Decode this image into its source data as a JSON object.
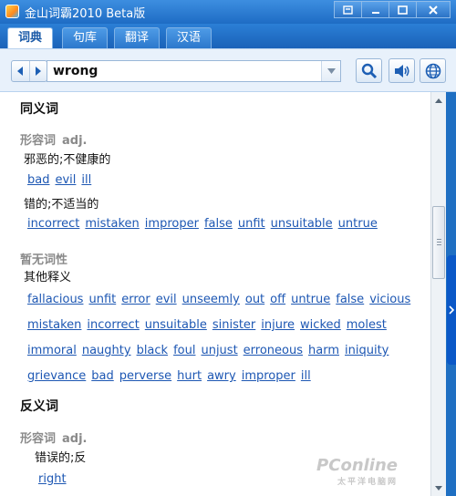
{
  "window": {
    "title": "金山词霸2010 Beta版"
  },
  "tabs": [
    {
      "label": "词典",
      "active": true
    },
    {
      "label": "句库",
      "active": false
    },
    {
      "label": "翻译",
      "active": false
    },
    {
      "label": "汉语",
      "active": false
    }
  ],
  "search": {
    "value": "wrong"
  },
  "icons": {
    "search": "search-icon",
    "speaker": "speaker-icon",
    "globe": "globe-icon"
  },
  "colors": {
    "accent": "#1f6fc2",
    "link": "#1d57b3"
  },
  "content": {
    "synonyms_title": "同义词",
    "syn_adj_cn": "形容词",
    "syn_adj_en": "adj.",
    "syn_gloss1": "邪恶的;不健康的",
    "syn_links1": [
      "bad",
      "evil",
      "ill"
    ],
    "syn_gloss2": "错的;不适当的",
    "syn_links2": [
      "incorrect",
      "mistaken",
      "improper",
      "false",
      "unfit",
      "unsuitable",
      "untrue"
    ],
    "syn_none_pos": "暂无词性",
    "syn_gloss3": "其他释义",
    "syn_links3a": [
      "fallacious",
      "unfit",
      "error",
      "evil",
      "unseemly",
      "out",
      "off",
      "untrue",
      "false",
      "vicious"
    ],
    "syn_links3b": [
      "mistaken",
      "incorrect",
      "unsuitable",
      "sinister",
      "injure",
      "wicked",
      "molest"
    ],
    "syn_links3c": [
      "immoral",
      "naughty",
      "black",
      "foul",
      "unjust",
      "erroneous",
      "harm",
      "iniquity"
    ],
    "syn_links3d": [
      "grievance",
      "bad",
      "perverse",
      "hurt",
      "awry",
      "improper",
      "ill"
    ],
    "antonyms_title": "反义词",
    "ant_adj_cn": "形容词",
    "ant_adj_en": "adj.",
    "ant_gloss1": "错误的;反",
    "ant_links1": [
      "right"
    ]
  },
  "watermark": {
    "text": "PConline",
    "sub": "太平洋电脑网"
  }
}
